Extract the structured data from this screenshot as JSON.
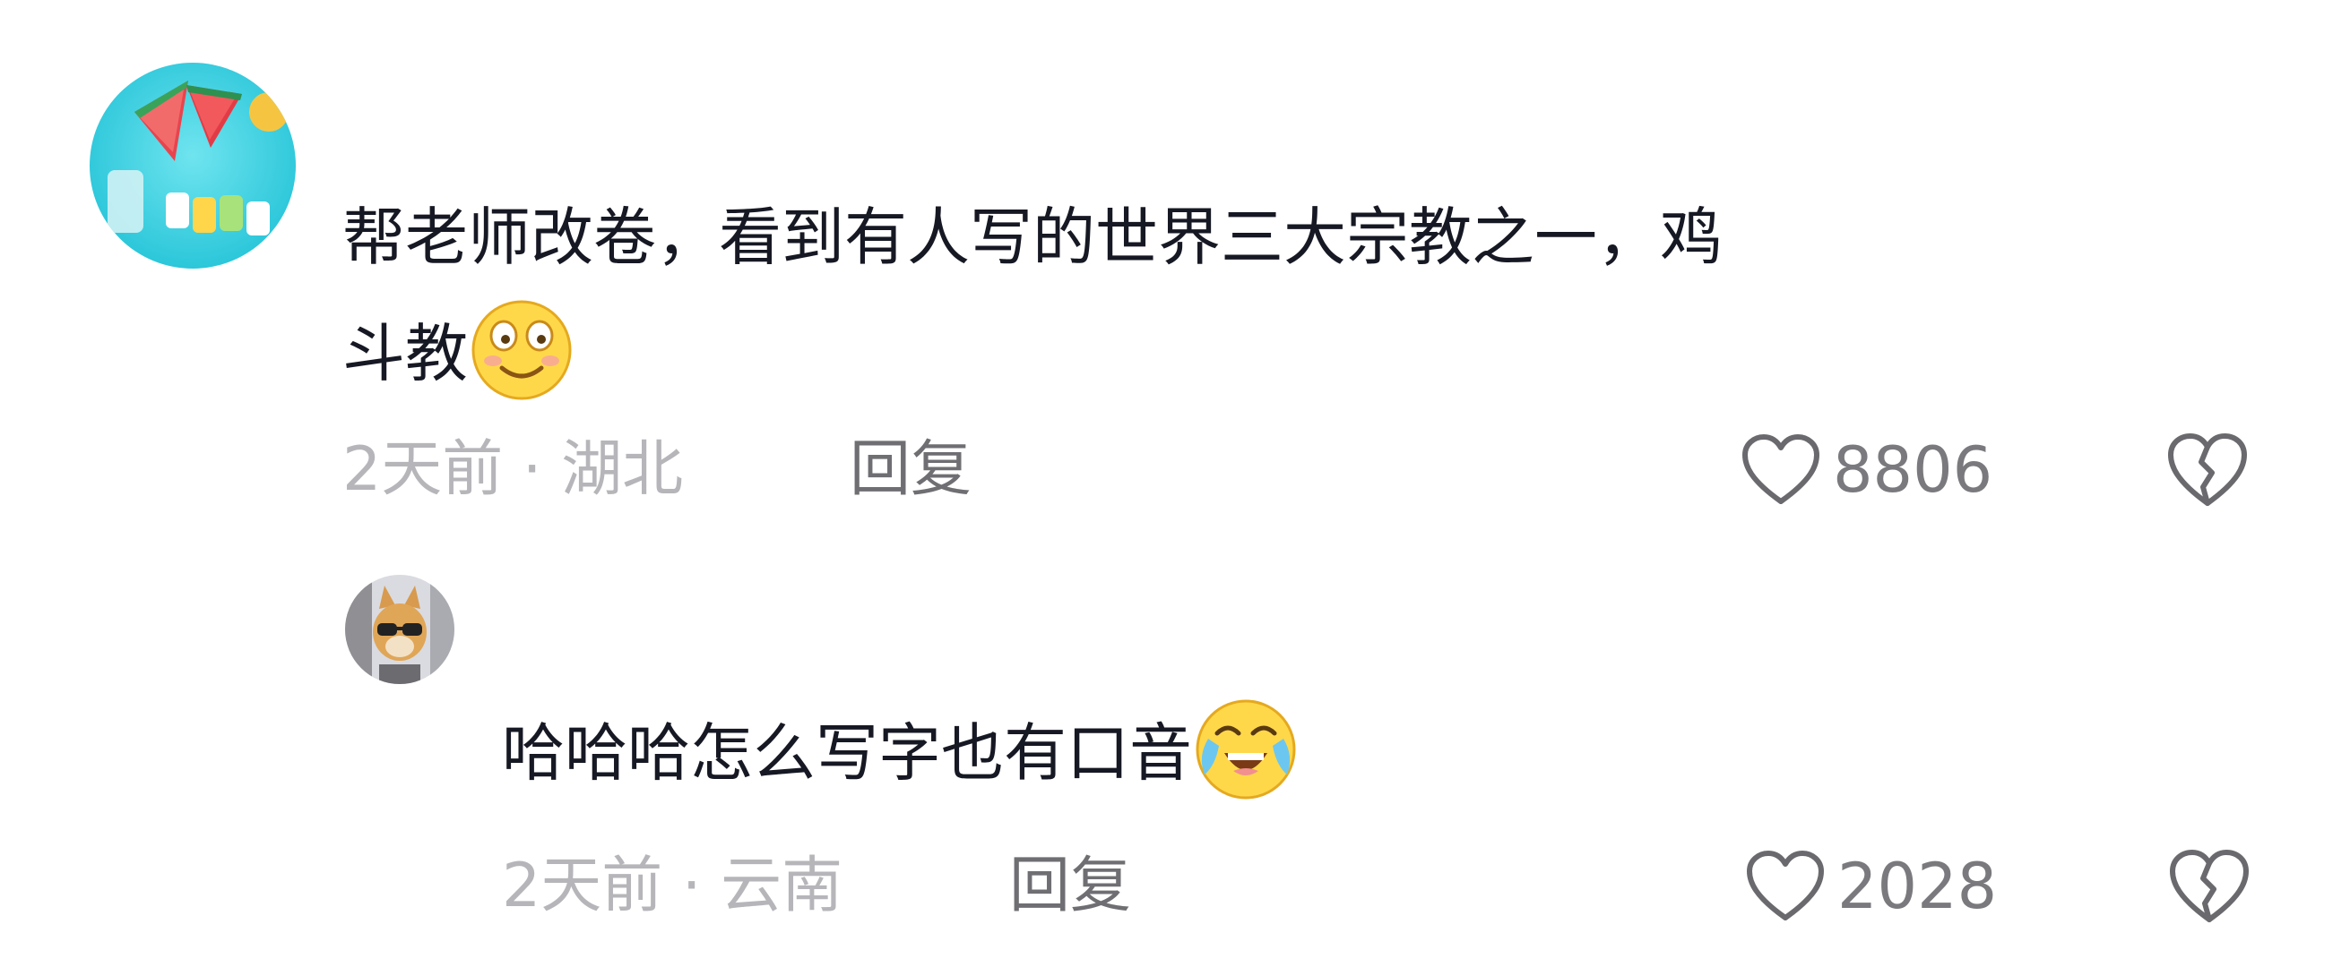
{
  "comments": [
    {
      "text_line1": "帮老师改卷，看到有人写的世界三大宗教之一，鸡",
      "text_line2": "斗教",
      "emoji": "smiling-face-emoji",
      "time_location": "2天前 · 湖北",
      "reply_label": "回复",
      "like_count": "8806",
      "avatar": "watermelon-avatar"
    },
    {
      "text": "哈哈哈怎么写字也有口音",
      "emoji": "laughing-crying-face-emoji",
      "time_location": "2天前 · 云南",
      "reply_label": "回复",
      "like_count": "2028",
      "avatar": "cat-sunglasses-avatar"
    }
  ],
  "icons": {
    "like": "heart-outline-icon",
    "dislike": "broken-heart-icon"
  },
  "colors": {
    "text": "#161823",
    "meta": "#b6b6ba",
    "reply": "#6f6f73",
    "icon": "#6a6a6e",
    "emoji_yellow": "#ffd84a"
  }
}
